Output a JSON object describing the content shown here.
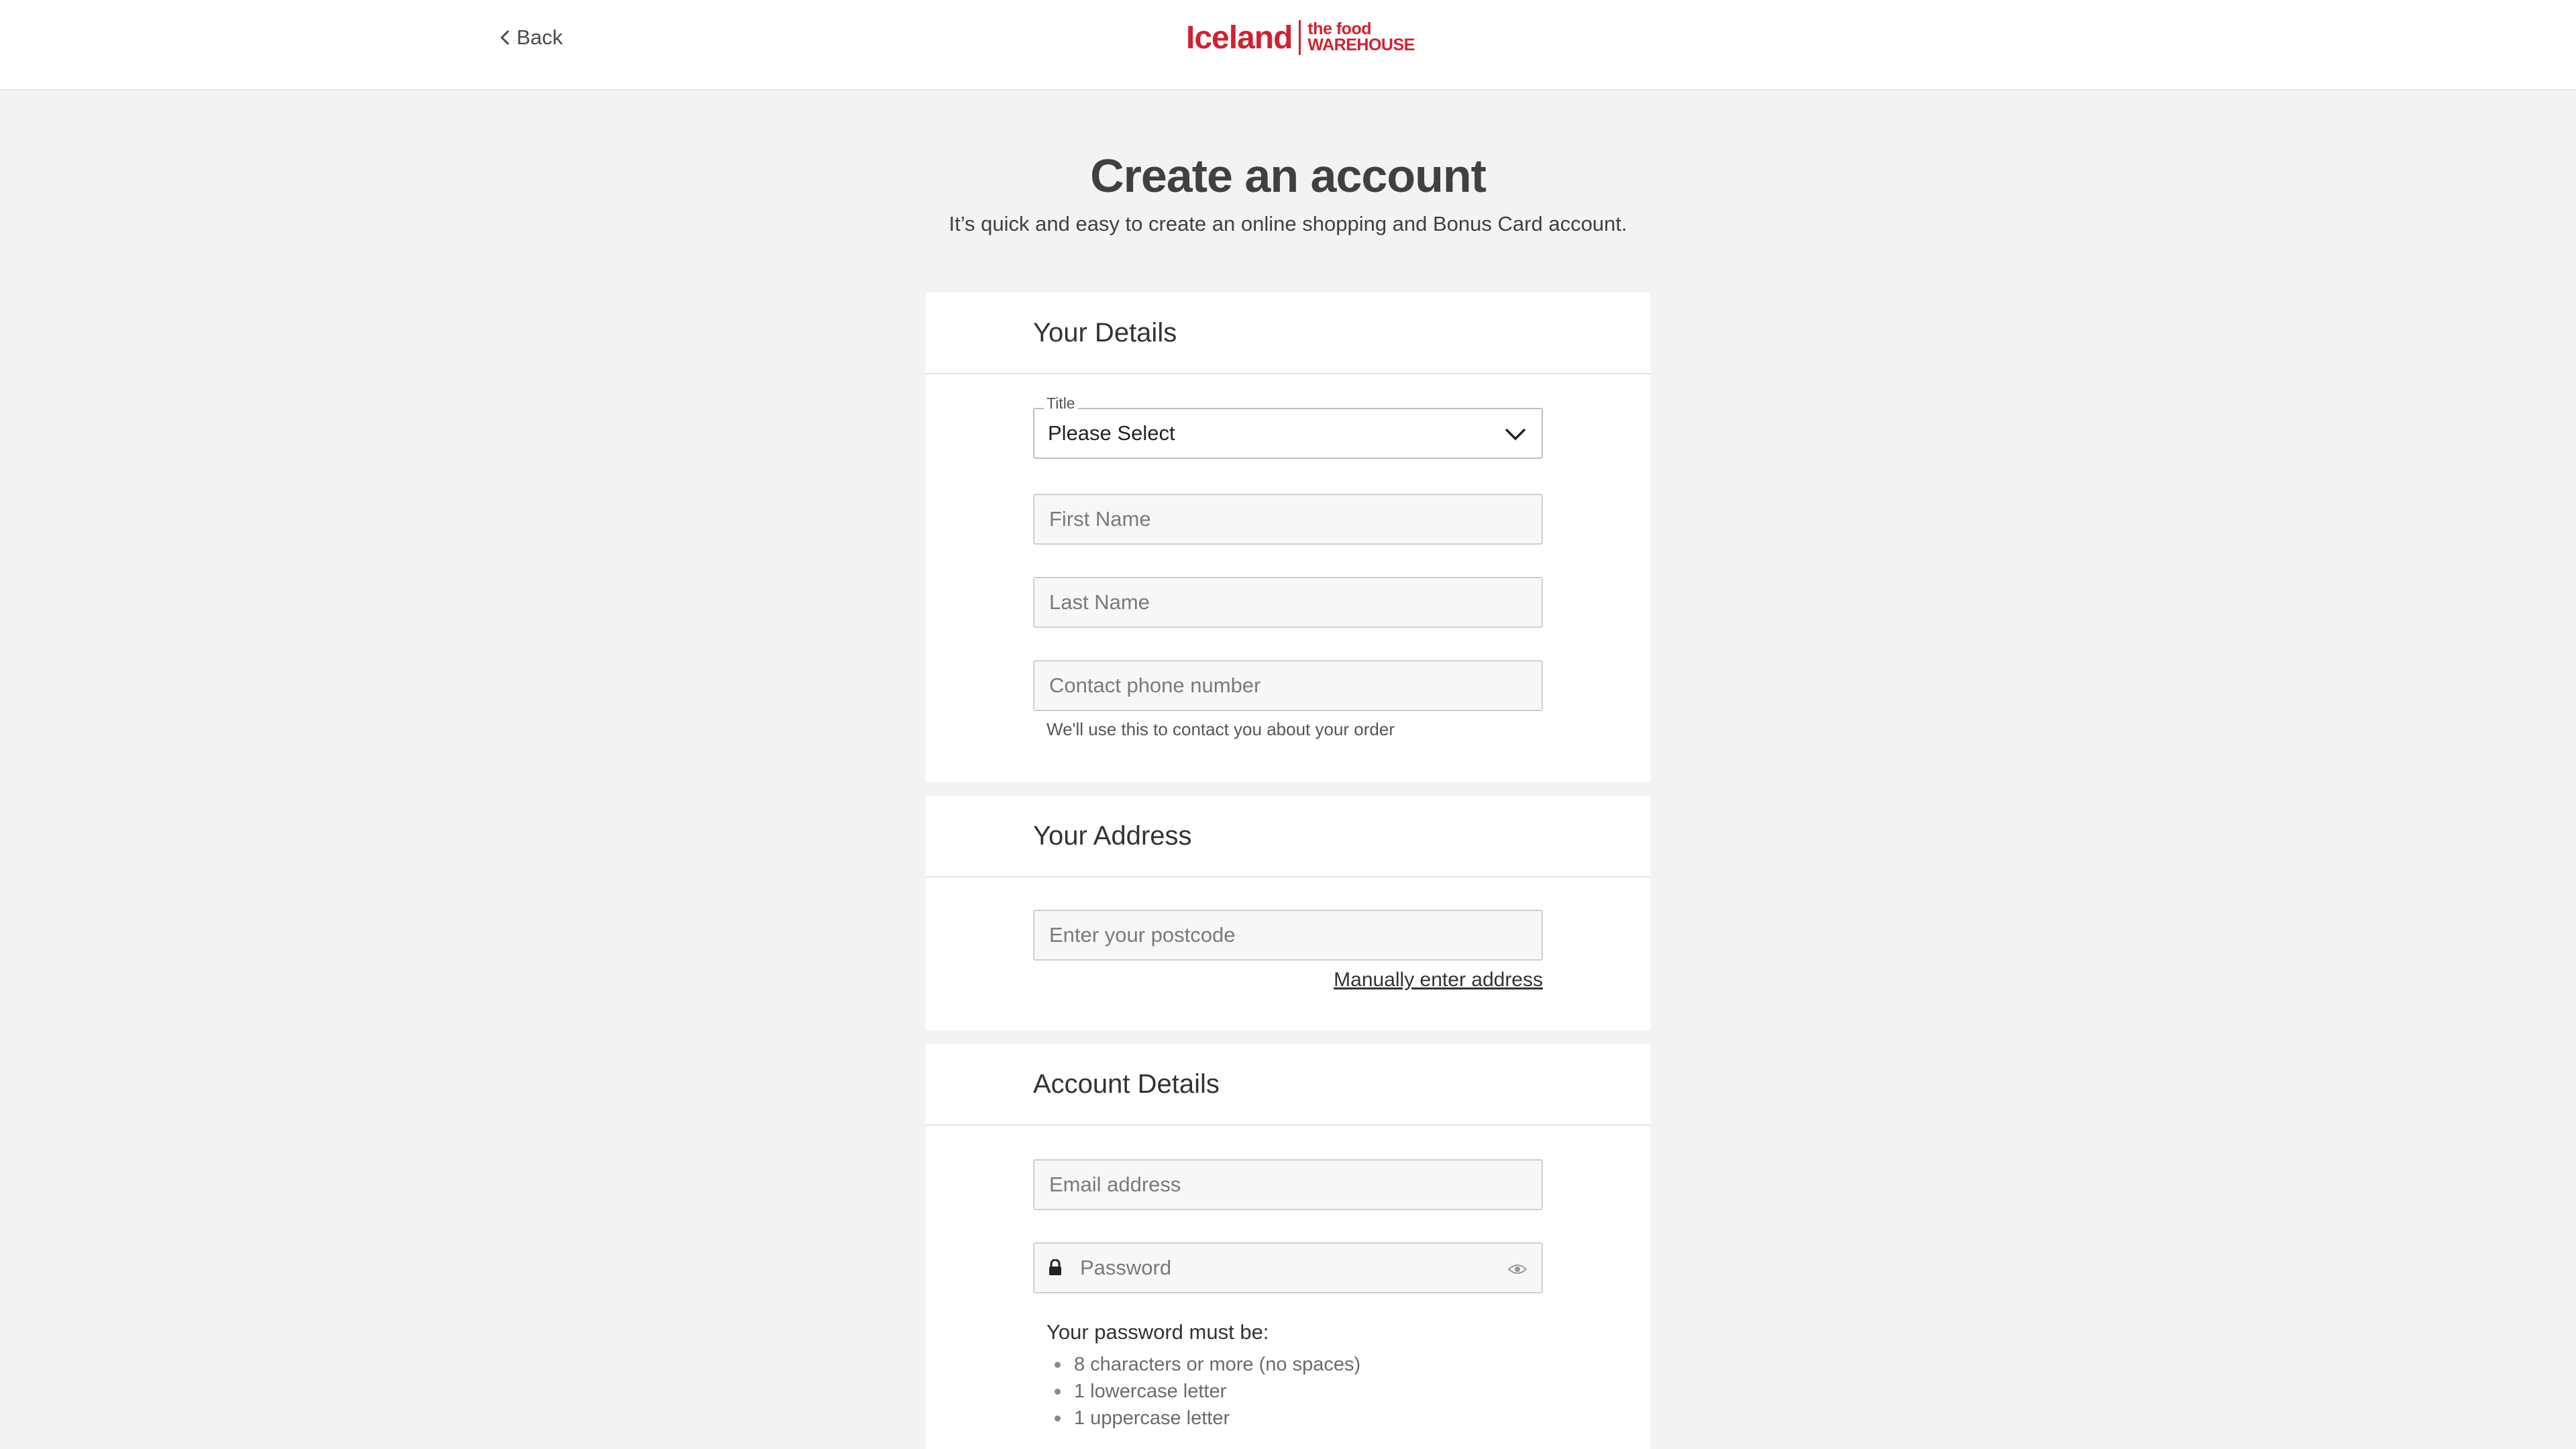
{
  "header": {
    "back_label": "Back",
    "logo_primary": "Iceland",
    "logo_secondary_line1": "the food",
    "logo_secondary_line2": "WAREHOUSE"
  },
  "page": {
    "title": "Create an account",
    "subtitle": "It’s quick and easy to create an online shopping and Bonus Card account."
  },
  "your_details": {
    "section_title": "Your Details",
    "title_field_label": "Title",
    "title_field_value": "Please Select",
    "first_name_placeholder": "First Name",
    "last_name_placeholder": "Last Name",
    "phone_placeholder": "Contact phone number",
    "phone_helper": "We'll use this to contact you about your order"
  },
  "your_address": {
    "section_title": "Your Address",
    "postcode_placeholder": "Enter your postcode",
    "manual_link": "Manually enter address"
  },
  "account_details": {
    "section_title": "Account Details",
    "email_placeholder": "Email address",
    "password_placeholder": "Password",
    "rules_title": "Your password must be:",
    "rules": [
      "8 characters or more (no spaces)",
      "1 lowercase letter",
      "1 uppercase letter"
    ]
  },
  "colors": {
    "brand_red": "#d2212e",
    "page_background": "#f3f3f3",
    "card_background": "#ffffff"
  },
  "icons": {
    "back": "chevron-left-icon",
    "title_select": "chevron-down-icon",
    "password_lock": "lock-icon",
    "password_toggle": "eye-icon"
  }
}
